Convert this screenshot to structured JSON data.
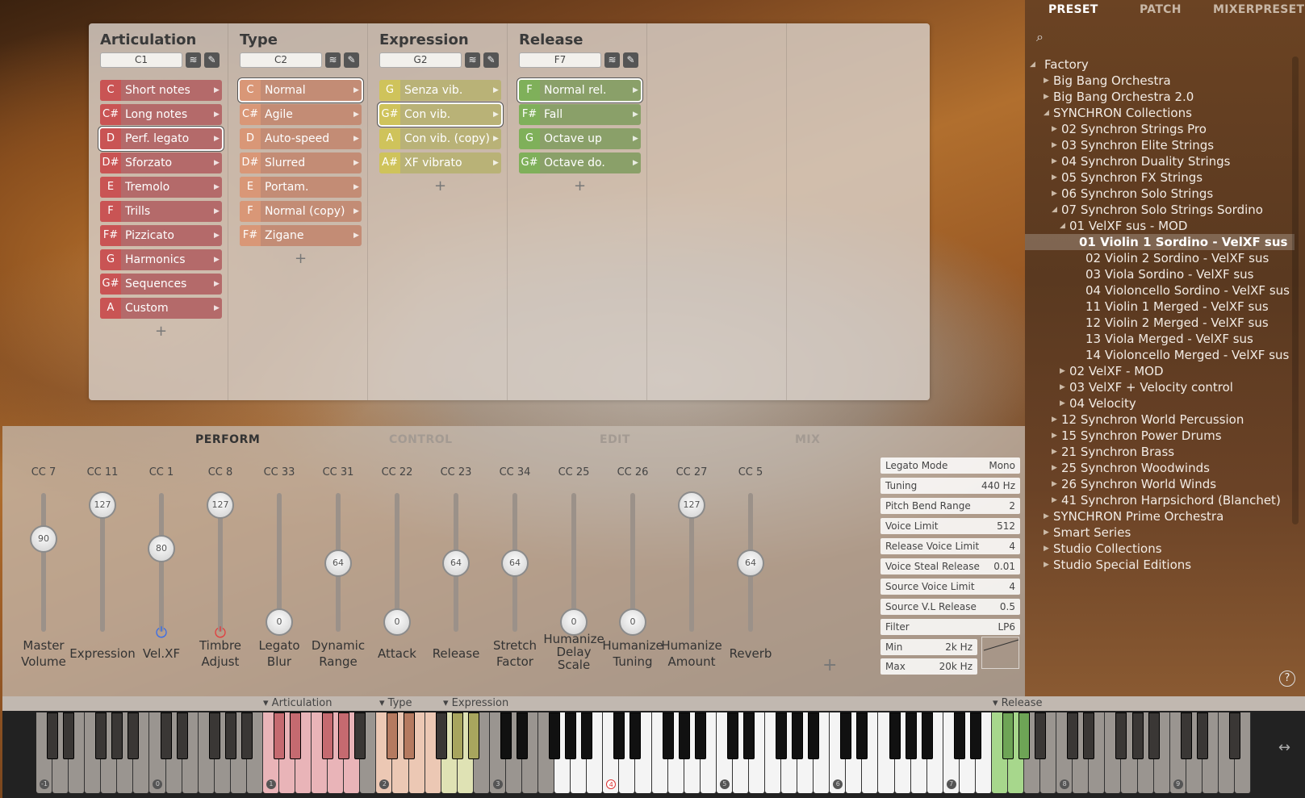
{
  "mapping": {
    "columns": [
      {
        "title": "Articulation",
        "key": "C1",
        "slots": [
          {
            "k": "C",
            "n": "Short notes"
          },
          {
            "k": "C#",
            "n": "Long notes"
          },
          {
            "k": "D",
            "n": "Perf. legato"
          },
          {
            "k": "D#",
            "n": "Sforzato"
          },
          {
            "k": "E",
            "n": "Tremolo"
          },
          {
            "k": "F",
            "n": "Trills"
          },
          {
            "k": "F#",
            "n": "Pizzicato"
          },
          {
            "k": "G",
            "n": "Harmonics"
          },
          {
            "k": "G#",
            "n": "Sequences"
          },
          {
            "k": "A",
            "n": "Custom"
          }
        ]
      },
      {
        "title": "Type",
        "key": "C2",
        "slots": [
          {
            "k": "C",
            "n": "Normal"
          },
          {
            "k": "C#",
            "n": "Agile"
          },
          {
            "k": "D",
            "n": "Auto-speed"
          },
          {
            "k": "D#",
            "n": "Slurred"
          },
          {
            "k": "E",
            "n": "Portam."
          },
          {
            "k": "F",
            "n": "Normal (copy)"
          },
          {
            "k": "F#",
            "n": "Zigane"
          }
        ]
      },
      {
        "title": "Expression",
        "key": "G2",
        "slots": [
          {
            "k": "G",
            "n": "Senza vib."
          },
          {
            "k": "G#",
            "n": "Con vib."
          },
          {
            "k": "A",
            "n": "Con vib. (copy)"
          },
          {
            "k": "A#",
            "n": "XF vibrato"
          }
        ]
      },
      {
        "title": "Release",
        "key": "F7",
        "slots": [
          {
            "k": "F",
            "n": "Normal rel."
          },
          {
            "k": "F#",
            "n": "Fall"
          },
          {
            "k": "G",
            "n": "Octave up"
          },
          {
            "k": "G#",
            "n": "Octave do."
          }
        ]
      }
    ],
    "add_label": "+"
  },
  "perform": {
    "tabs": [
      "PERFORM",
      "CONTROL",
      "EDIT",
      "MIX"
    ],
    "faders": [
      {
        "cc": "CC 7",
        "value": "90",
        "label": [
          "Master",
          "Volume"
        ]
      },
      {
        "cc": "CC 11",
        "value": "127",
        "label": [
          "Expression"
        ]
      },
      {
        "cc": "CC 1",
        "value": "80",
        "label": [
          "Vel.XF"
        ]
      },
      {
        "cc": "CC 8",
        "value": "127",
        "label": [
          "Timbre",
          "Adjust"
        ]
      },
      {
        "cc": "CC 33",
        "value": "0",
        "label": [
          "Legato",
          "Blur"
        ]
      },
      {
        "cc": "CC 31",
        "value": "64",
        "label": [
          "Dynamic",
          "Range"
        ]
      },
      {
        "cc": "CC 22",
        "value": "0",
        "label": [
          "Attack"
        ]
      },
      {
        "cc": "CC 23",
        "value": "64",
        "label": [
          "Release"
        ]
      },
      {
        "cc": "CC 34",
        "value": "64",
        "label": [
          "Stretch",
          "Factor"
        ]
      },
      {
        "cc": "CC 25",
        "value": "0",
        "label": [
          "Humanize",
          "Delay",
          "Scale"
        ]
      },
      {
        "cc": "CC 26",
        "value": "0",
        "label": [
          "Humanize",
          "Tuning"
        ]
      },
      {
        "cc": "CC 27",
        "value": "127",
        "label": [
          "Humanize",
          "Amount"
        ]
      },
      {
        "cc": "CC 5",
        "value": "64",
        "label": [
          "Reverb"
        ]
      }
    ],
    "add_label": "+",
    "params": [
      {
        "name": "Legato Mode",
        "value": "Mono"
      },
      {
        "name": "Tuning",
        "value": "440 Hz"
      },
      {
        "name": "Pitch Bend Range",
        "value": "2"
      },
      {
        "name": "Voice Limit",
        "value": "512"
      },
      {
        "name": "Release Voice Limit",
        "value": "4"
      },
      {
        "name": "Voice Steal Release",
        "value": "0.01"
      },
      {
        "name": "Source Voice Limit",
        "value": "4"
      },
      {
        "name": "Source V.L Release",
        "value": "0.5"
      },
      {
        "name": "Filter",
        "value": "LP6"
      },
      {
        "name": "Min",
        "value": "2k Hz"
      },
      {
        "name": "Max",
        "value": "20k Hz"
      }
    ]
  },
  "keyboard": {
    "zones": [
      "Articulation",
      "Type",
      "Expression",
      "Release"
    ],
    "octaves": [
      "-1",
      "0",
      "1",
      "2",
      "3",
      "4",
      "5",
      "6",
      "7",
      "8",
      "9"
    ],
    "resize_icon": "↔"
  },
  "browser": {
    "tabs": [
      "PRESET",
      "PATCH",
      "MIXERPRESET"
    ],
    "tree": [
      {
        "t": "Factory",
        "d": 0,
        "tri": "open"
      },
      {
        "t": "Big Bang Orchestra",
        "d": 1,
        "tri": "closed"
      },
      {
        "t": "Big Bang Orchestra 2.0",
        "d": 1,
        "tri": "closed"
      },
      {
        "t": "SYNCHRON Collections",
        "d": 1,
        "tri": "open"
      },
      {
        "t": "02 Synchron Strings Pro",
        "d": 2,
        "tri": "closed"
      },
      {
        "t": "03 Synchron Elite Strings",
        "d": 2,
        "tri": "closed"
      },
      {
        "t": "04 Synchron Duality Strings",
        "d": 2,
        "tri": "closed"
      },
      {
        "t": "05 Synchron FX Strings",
        "d": 2,
        "tri": "closed"
      },
      {
        "t": "06 Synchron Solo Strings",
        "d": 2,
        "tri": "closed"
      },
      {
        "t": "07 Synchron Solo Strings Sordino",
        "d": 2,
        "tri": "open"
      },
      {
        "t": "01 VelXF sus - MOD",
        "d": 3,
        "tri": "open"
      },
      {
        "t": "01 Violin 1 Sordino - VelXF sus",
        "d": 4,
        "tri": "",
        "sel": true
      },
      {
        "t": "02 Violin 2 Sordino - VelXF sus",
        "d": 4,
        "tri": ""
      },
      {
        "t": "03 Viola Sordino - VelXF sus",
        "d": 4,
        "tri": ""
      },
      {
        "t": "04 Violoncello Sordino - VelXF sus",
        "d": 4,
        "tri": ""
      },
      {
        "t": "11 Violin 1 Merged - VelXF sus",
        "d": 4,
        "tri": ""
      },
      {
        "t": "12 Violin 2 Merged - VelXF sus",
        "d": 4,
        "tri": ""
      },
      {
        "t": "13 Viola Merged - VelXF sus",
        "d": 4,
        "tri": ""
      },
      {
        "t": "14 Violoncello Merged - VelXF sus",
        "d": 4,
        "tri": ""
      },
      {
        "t": "02 VelXF - MOD",
        "d": 3,
        "tri": "closed"
      },
      {
        "t": "03 VelXF + Velocity control",
        "d": 3,
        "tri": "closed"
      },
      {
        "t": "04 Velocity",
        "d": 3,
        "tri": "closed"
      },
      {
        "t": "12 Synchron World Percussion",
        "d": 2,
        "tri": "closed"
      },
      {
        "t": "15 Synchron Power Drums",
        "d": 2,
        "tri": "closed"
      },
      {
        "t": "21 Synchron Brass",
        "d": 2,
        "tri": "closed"
      },
      {
        "t": "25 Synchron Woodwinds",
        "d": 2,
        "tri": "closed"
      },
      {
        "t": "26 Synchron World Winds",
        "d": 2,
        "tri": "closed"
      },
      {
        "t": "41 Synchron Harpsichord (Blanchet)",
        "d": 2,
        "tri": "closed"
      },
      {
        "t": "SYNCHRON Prime Orchestra",
        "d": 1,
        "tri": "closed"
      },
      {
        "t": "Smart Series",
        "d": 1,
        "tri": "closed"
      },
      {
        "t": "Studio Collections",
        "d": 1,
        "tri": "closed"
      },
      {
        "t": "Studio Special Editions",
        "d": 1,
        "tri": "closed"
      }
    ],
    "help": "?"
  }
}
